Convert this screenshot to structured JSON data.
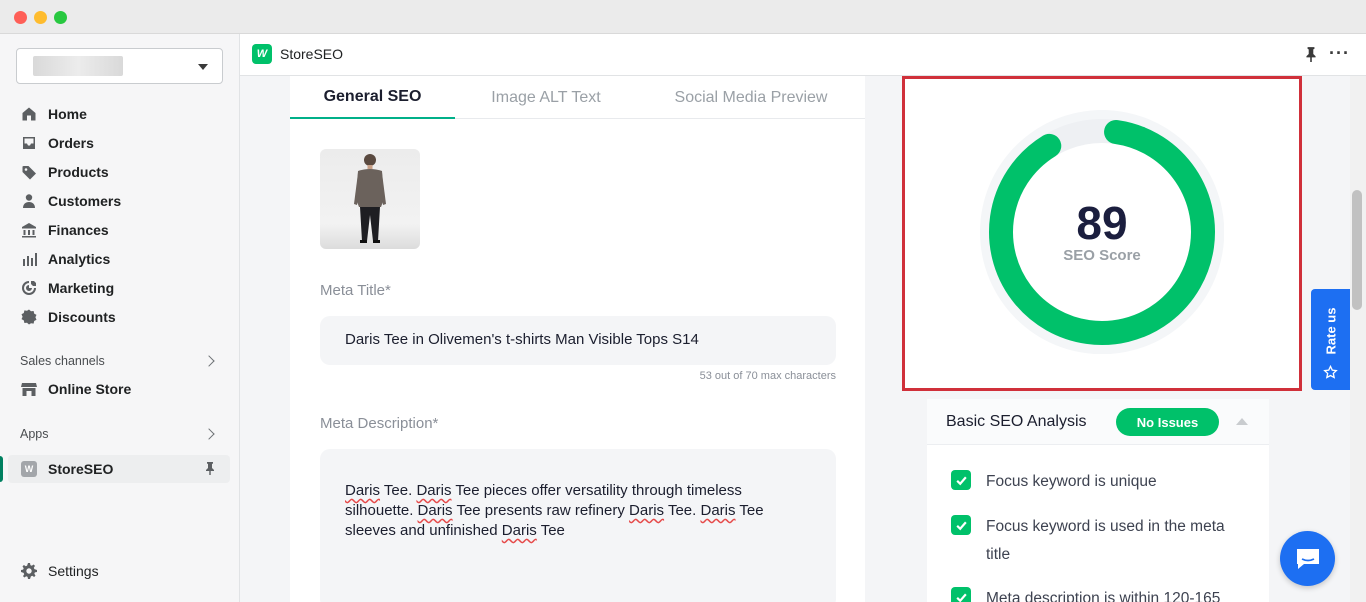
{
  "window": {
    "controls": [
      "close",
      "minimize",
      "maximize"
    ]
  },
  "sidebar": {
    "store_selector_value": "",
    "items": [
      {
        "label": "Home",
        "icon": "home-icon"
      },
      {
        "label": "Orders",
        "icon": "orders-icon"
      },
      {
        "label": "Products",
        "icon": "tag-icon"
      },
      {
        "label": "Customers",
        "icon": "person-icon"
      },
      {
        "label": "Finances",
        "icon": "bank-icon"
      },
      {
        "label": "Analytics",
        "icon": "bar-chart-icon"
      },
      {
        "label": "Marketing",
        "icon": "target-icon"
      },
      {
        "label": "Discounts",
        "icon": "discount-icon"
      }
    ],
    "sales_channels_label": "Sales channels",
    "online_store_label": "Online Store",
    "apps_label": "Apps",
    "app_item_label": "StoreSEO",
    "settings_label": "Settings"
  },
  "header": {
    "app_title": "StoreSEO"
  },
  "tabs": [
    {
      "label": "General SEO",
      "active": true
    },
    {
      "label": "Image ALT Text",
      "active": false
    },
    {
      "label": "Social Media Preview",
      "active": false
    }
  ],
  "meta_title": {
    "label": "Meta Title*",
    "value": "Daris Tee in Olivemen's t-shirts Man Visible Tops S14",
    "char_count": "53 out of 70 max characters"
  },
  "meta_description": {
    "label": "Meta Description*",
    "line1_a": "Daris",
    "line1_b": " Tee. ",
    "line1_c": "Daris",
    "line1_d": " Tee pieces offer versatility through timeless",
    "line2_a": "silhouette. ",
    "line2_b": "Daris",
    "line2_c": " Tee presents raw refinery ",
    "line2_d": "Daris",
    "line2_e": " Tee. ",
    "line2_f": "Daris",
    "line2_g": " Tee",
    "line3_a": "sleeves and unfinished ",
    "line3_b": "Daris",
    "line3_c": " Tee"
  },
  "score": {
    "value": 89,
    "display": "89",
    "label": "SEO Score",
    "color": "#00c16a"
  },
  "analysis": {
    "title": "Basic SEO Analysis",
    "badge": "No Issues",
    "checks": [
      "Focus keyword is unique",
      "Focus keyword is used in the meta",
      "title",
      "Meta description is within 120-165"
    ]
  },
  "rate_us_label": "Rate us"
}
